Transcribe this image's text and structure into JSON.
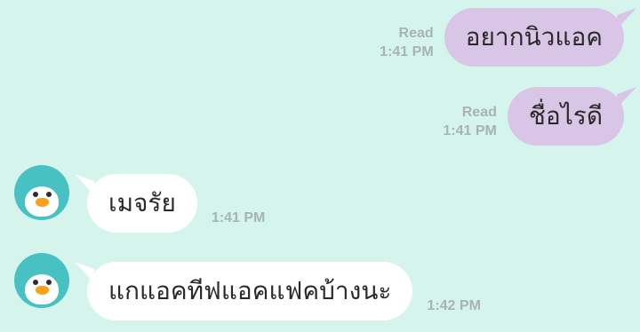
{
  "messages": [
    {
      "direction": "out",
      "text": "อยากนิวแอค",
      "status": "Read",
      "time": "1:41 PM"
    },
    {
      "direction": "out",
      "text": "ชื่อไรดี",
      "status": "Read",
      "time": "1:41 PM"
    },
    {
      "direction": "in",
      "text": "เมจรัย",
      "time": "1:41 PM",
      "avatar_icon": "penguin-icon"
    },
    {
      "direction": "in",
      "text": "แกแอคทีฟแอคแฟคบ้างนะ",
      "time": "1:42 PM",
      "avatar_icon": "penguin-icon"
    }
  ],
  "colors": {
    "background": "#d5f5ec",
    "outgoing_bubble": "#d9c6e6",
    "incoming_bubble": "#ffffff",
    "meta_text": "#a7b4b1",
    "avatar": "#48c1c3",
    "beak": "#f6a21e"
  }
}
